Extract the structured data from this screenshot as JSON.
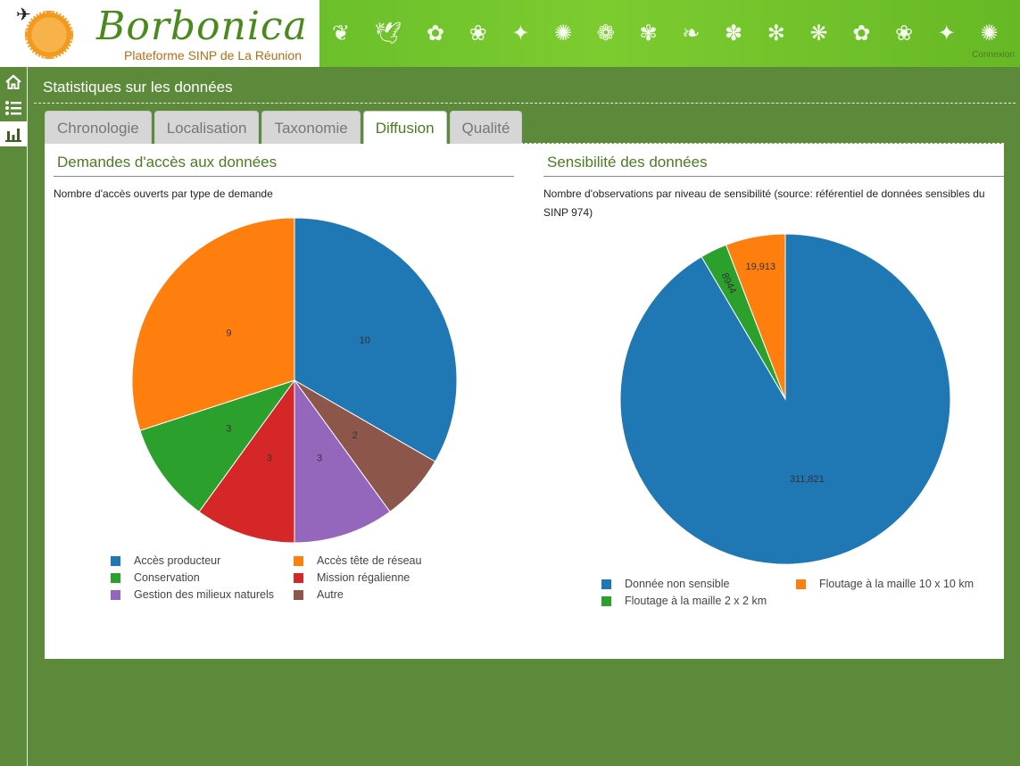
{
  "header": {
    "brand": "Borbonica",
    "subtitle": "Plateforme SINP de La Réunion",
    "banner_link": "Connexion"
  },
  "sidebar": {
    "items": [
      {
        "icon": "home-icon",
        "active": false
      },
      {
        "icon": "list-icon",
        "active": false
      },
      {
        "icon": "bar-chart-icon",
        "active": true
      }
    ]
  },
  "page": {
    "title": "Statistiques sur les données"
  },
  "tabs": [
    {
      "label": "Chronologie",
      "active": false
    },
    {
      "label": "Localisation",
      "active": false
    },
    {
      "label": "Taxonomie",
      "active": false
    },
    {
      "label": "Diffusion",
      "active": true
    },
    {
      "label": "Qualité",
      "active": false
    }
  ],
  "left_card": {
    "title": "Demandes d'accès aux données",
    "description": "Nombre d'accès ouverts par type de demande"
  },
  "right_card": {
    "title": "Sensibilité des données",
    "description": "Nombre d'observations par niveau de sensibilité (source: référentiel de données sensibles du SINP 974)"
  },
  "chart_data": [
    {
      "type": "pie",
      "categories": [
        "Accès producteur",
        "Autre",
        "Gestion des milieux naturels",
        "Mission régalienne",
        "Conservation",
        "Accès tête de réseau"
      ],
      "values": [
        10,
        2,
        3,
        3,
        3,
        9
      ],
      "labels": [
        "10",
        "2",
        "3",
        "3",
        "3",
        "9"
      ],
      "colors": [
        "#1f77b4",
        "#8c564b",
        "#9467bd",
        "#d62728",
        "#2ca02c",
        "#ff7f0e"
      ],
      "legend": [
        {
          "label": "Accès producteur",
          "color": "#1f77b4"
        },
        {
          "label": "Accès tête de réseau",
          "color": "#ff7f0e"
        },
        {
          "label": "Conservation",
          "color": "#2ca02c"
        },
        {
          "label": "Mission régalienne",
          "color": "#d62728"
        },
        {
          "label": "Gestion des milieux naturels",
          "color": "#9467bd"
        },
        {
          "label": "Autre",
          "color": "#8c564b"
        }
      ],
      "legend_position": "bottom"
    },
    {
      "type": "pie",
      "categories": [
        "Donnée non sensible",
        "Floutage à la maille 2 x 2 km",
        "Floutage à la maille 10 x 10 km"
      ],
      "values": [
        311821,
        8944,
        19913
      ],
      "labels": [
        "311,821",
        "8944",
        "19,913"
      ],
      "colors": [
        "#1f77b4",
        "#2ca02c",
        "#ff7f0e"
      ],
      "legend": [
        {
          "label": "Donnée non sensible",
          "color": "#1f77b4"
        },
        {
          "label": "Floutage à la maille 10 x 10 km",
          "color": "#ff7f0e"
        },
        {
          "label": "Floutage à la maille 2 x 2 km",
          "color": "#2ca02c"
        }
      ],
      "legend_position": "bottom"
    }
  ]
}
